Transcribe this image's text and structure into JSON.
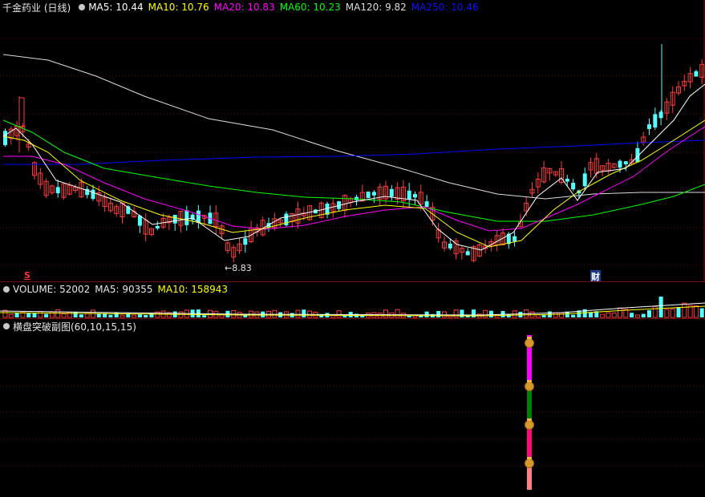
{
  "price": {
    "title": "千金药业 (日线)",
    "ma": [
      {
        "label": "MA5: 10.44",
        "color": "#ffffff"
      },
      {
        "label": "MA10: 10.76",
        "color": "#ffff00"
      },
      {
        "label": "MA20: 10.83",
        "color": "#ff00ff"
      },
      {
        "label": "MA60: 10.23",
        "color": "#00ff00"
      },
      {
        "label": "MA120: 9.82",
        "color": "#dcdcdc"
      },
      {
        "label": "MA250: 10.46",
        "color": "#0000ff"
      }
    ],
    "low_marker": "8.83",
    "fin_marker": "财",
    "s_marker": "S"
  },
  "volume": {
    "title": "VOLUME: 52002",
    "ma5": "MA5: 90355",
    "ma10": "MA10: 158943"
  },
  "indicator": {
    "title": "横盘突破副图(60,10,15,15)"
  },
  "colors": {
    "up": "#ff3b3b",
    "down": "#54ffff",
    "grid": "#5a0000",
    "ma5": "#ffffff",
    "ma10": "#ffff00",
    "ma20": "#ff00ff",
    "ma60": "#00ff00",
    "ma120": "#dcdcdc",
    "ma250": "#0000ff"
  },
  "icons": {
    "money": "money-bag-icon"
  }
}
